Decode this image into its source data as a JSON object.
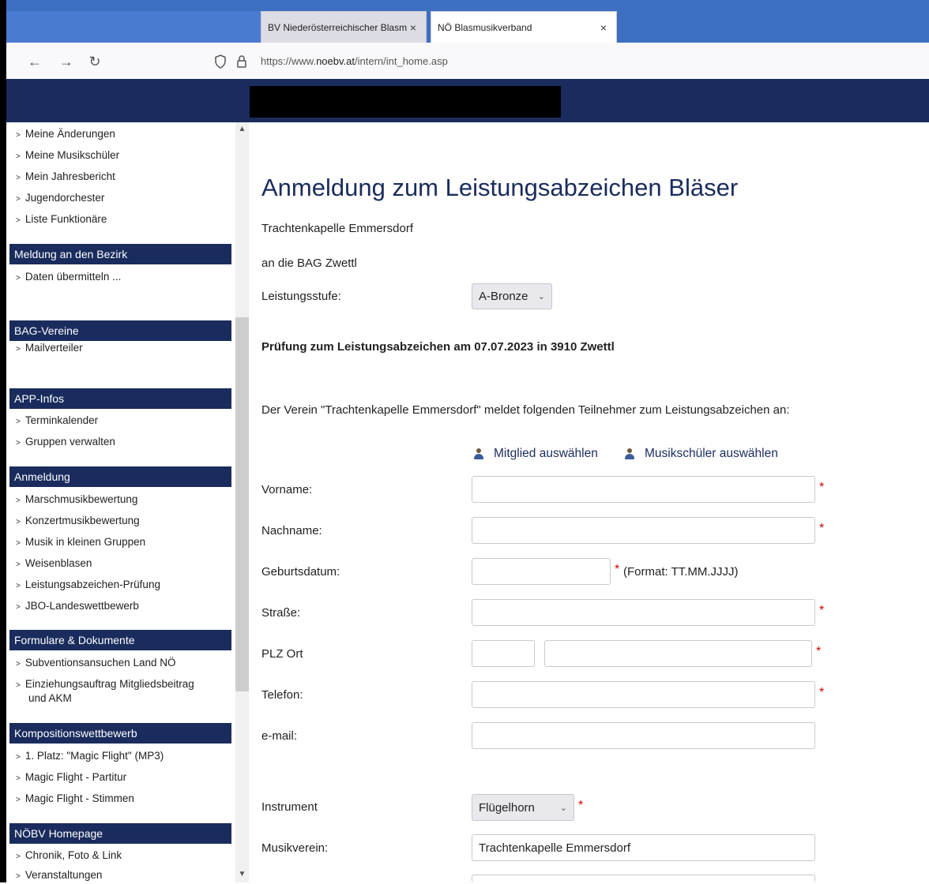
{
  "browser": {
    "tabs": [
      {
        "label": "BV Niederösterreichischer Blasm",
        "close": "×"
      },
      {
        "label": "NÖ Blasmusikverband",
        "close": "×"
      }
    ],
    "url_prefix": "https://www.",
    "url_domain": "noebv.at",
    "url_path": "/intern/int_home.asp"
  },
  "sidebar": {
    "items_top": [
      "Meine Änderungen",
      "Meine Musikschüler",
      "Mein Jahresbericht",
      "Jugendorchester",
      "Liste Funktionäre"
    ],
    "section_bezirk": {
      "title": "Meldung an den Bezirk",
      "items": [
        "Daten übermitteln ..."
      ]
    },
    "section_bag": {
      "title": "BAG-Vereine",
      "items": [
        "Mailverteiler"
      ]
    },
    "section_app": {
      "title": "APP-Infos",
      "items": [
        "Terminkalender",
        "Gruppen verwalten"
      ]
    },
    "section_anmeldung": {
      "title": "Anmeldung",
      "items": [
        "Marschmusikbewertung",
        "Konzertmusikbewertung",
        "Musik in kleinen Gruppen",
        "Weisenblasen",
        "Leistungsabzeichen-Prüfung",
        "JBO-Landeswettbewerb"
      ]
    },
    "section_formulare": {
      "title": "Formulare & Dokumente",
      "items": [
        "Subventionsansuchen Land NÖ",
        "Einziehungsauftrag Mitgliedsbeitrag",
        "und AKM"
      ]
    },
    "section_komposition": {
      "title": "Kompositionswettbewerb",
      "items": [
        "1. Platz: \"Magic Flight\" (MP3)",
        "Magic Flight - Partitur",
        "Magic Flight - Stimmen"
      ]
    },
    "section_homepage": {
      "title": "NÖBV Homepage",
      "items": [
        "Chronik, Foto & Link",
        "Veranstaltungen"
      ]
    }
  },
  "main": {
    "title": "Anmeldung zum Leistungsabzeichen Bläser",
    "verein": "Trachtenkapelle Emmersdorf",
    "an": "an die BAG Zwettl",
    "stufe_label": "Leistungsstufe:",
    "stufe_value": "A-Bronze",
    "pruefung": "Prüfung zum Leistungsabzeichen am 07.07.2023 in 3910 Zwettl",
    "intro": "Der Verein \"Trachtenkapelle Emmersdorf\" meldet folgenden Teilnehmer zum Leistungsabzeichen an:",
    "link_mitglied": "Mitglied auswählen",
    "link_schueler": "Musikschüler auswählen",
    "labels": {
      "vorname": "Vorname:",
      "nachname": "Nachname:",
      "geburtsdatum": "Geburtsdatum:",
      "strasse": "Straße:",
      "plz_ort": "PLZ Ort",
      "telefon": "Telefon:",
      "email": "e-mail:",
      "instrument": "Instrument",
      "musikverein": "Musikverein:"
    },
    "required_mark": "*",
    "date_format_hint": "(Format: TT.MM.JJJJ)",
    "instrument_value": "Flügelhorn",
    "musikverein_value": "Trachtenkapelle Emmersdorf"
  },
  "colors": {
    "navy": "#1a2c5d",
    "required": "#d40000",
    "tabbar": "#3f6fc1"
  },
  "icons": [
    "back-arrow-icon",
    "forward-arrow-icon",
    "reload-icon",
    "shield-icon",
    "lock-icon",
    "person-icon",
    "chevron-right-icon",
    "chevron-down-icon"
  ]
}
